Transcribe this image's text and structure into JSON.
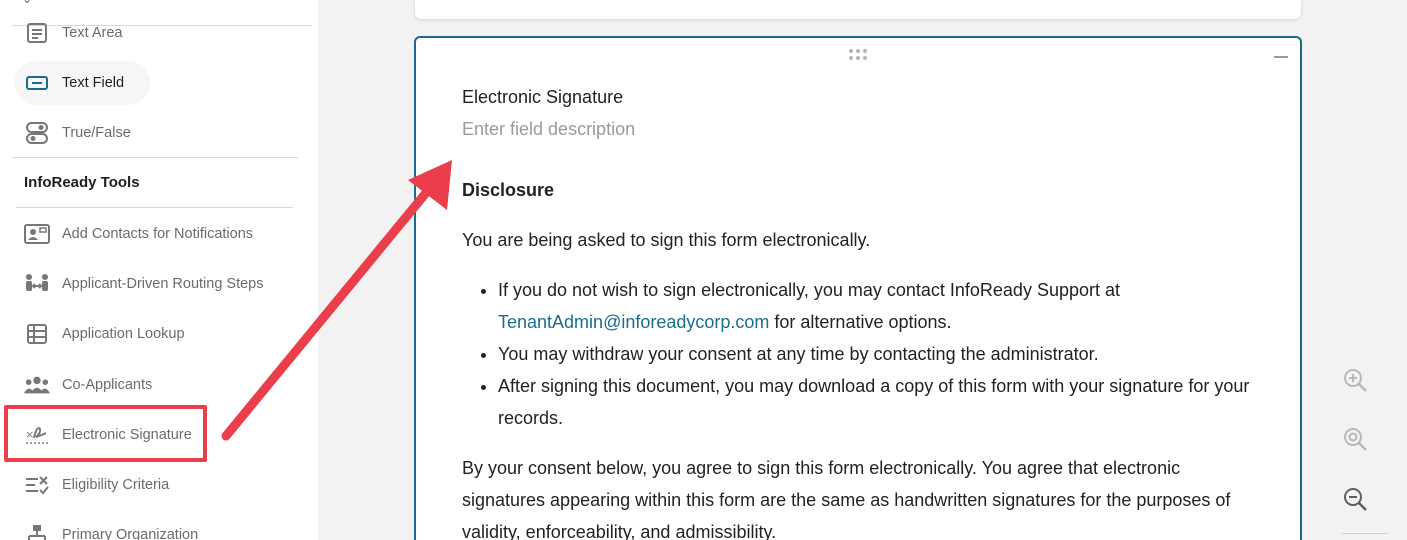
{
  "sidebar": {
    "items_top": [
      {
        "label": "Text Area",
        "icon": "text-area-icon"
      },
      {
        "label": "Text Field",
        "icon": "text-field-icon"
      },
      {
        "label": "True/False",
        "icon": "toggle-icon"
      }
    ],
    "heading": "InfoReady Tools",
    "items_tools": [
      {
        "label": "Add Contacts for Notifications",
        "icon": "contact-card-icon"
      },
      {
        "label": "Applicant-Driven Routing Steps",
        "icon": "routing-icon"
      },
      {
        "label": "Application Lookup",
        "icon": "table-lookup-icon"
      },
      {
        "label": "Co-Applicants",
        "icon": "users-icon"
      },
      {
        "label": "Electronic Signature",
        "icon": "signature-icon"
      },
      {
        "label": "Eligibility Criteria",
        "icon": "checklist-icon"
      },
      {
        "label": "Primary Organization",
        "icon": "org-chart-icon"
      }
    ]
  },
  "field": {
    "title": "Electronic Signature",
    "description_placeholder": "Enter field description",
    "disclosure_heading": "Disclosure",
    "intro": "You are being asked to sign this form electronically.",
    "bullet1_pre": "If you do not wish to sign electronically, you may contact InfoReady Support at",
    "bullet1_link": "TenantAdmin@inforeadycorp.com",
    "bullet1_post": " for alternative options.",
    "bullet2": "You may withdraw your consent at any time by contacting the administrator.",
    "bullet3": "After signing this document, you may download a copy of this form with your signature for your records.",
    "consent": "By your consent below, you agree to sign this form electronically. You agree that electronic signatures appearing within this form are the same as handwritten signatures for the purposes of validity, enforceability, and admissibility."
  },
  "colors": {
    "accent": "#1e6a8d",
    "highlight": "#ea3e4a",
    "link": "#1a6d8c"
  }
}
